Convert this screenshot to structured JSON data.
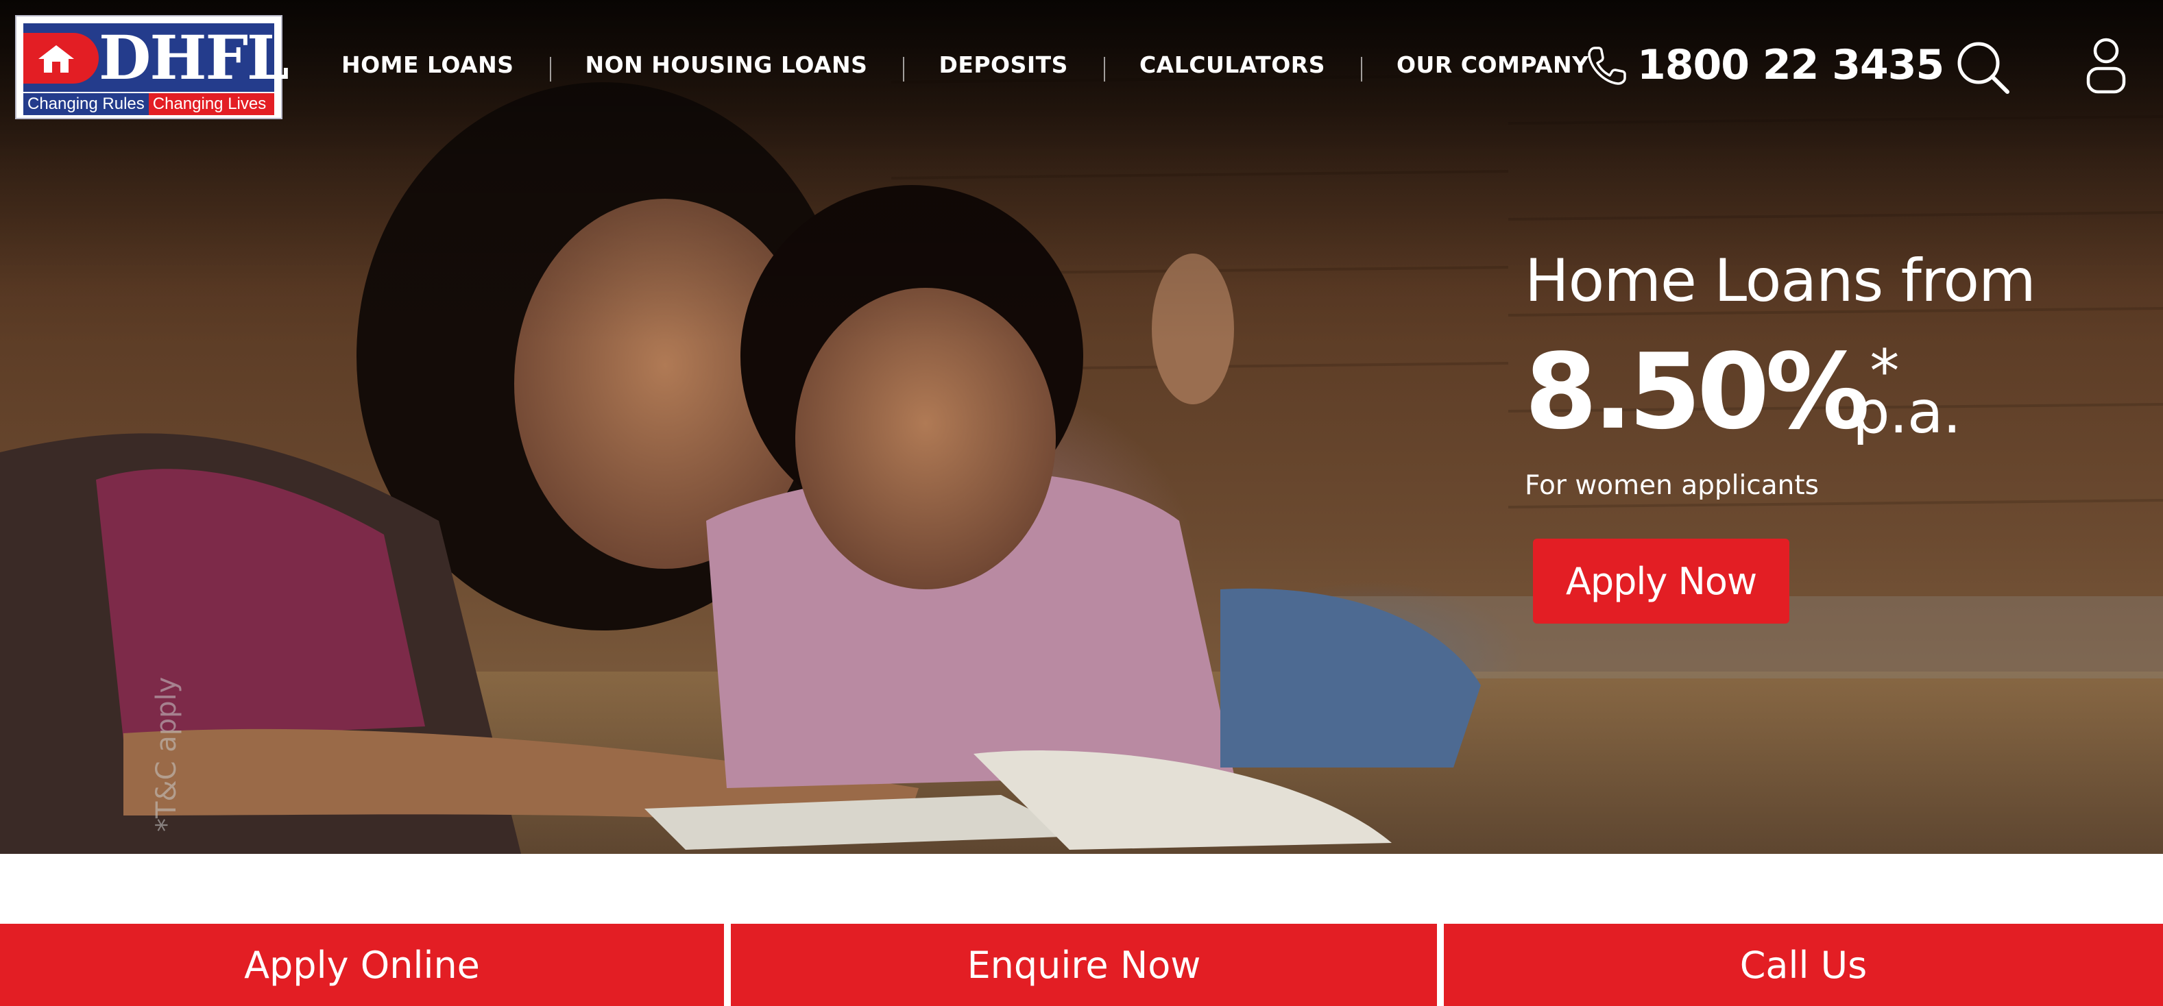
{
  "brand": {
    "logo_text": "DHFL",
    "tagline_part1": "Changing Rules",
    "tagline_part2": "Changing Lives",
    "colors": {
      "red": "#e31e24",
      "blue": "#243c8c"
    }
  },
  "nav": {
    "items": [
      {
        "label": "HOME LOANS"
      },
      {
        "label": "NON HOUSING LOANS"
      },
      {
        "label": "DEPOSITS"
      },
      {
        "label": "CALCULATORS"
      },
      {
        "label": "OUR COMPANY"
      }
    ]
  },
  "header": {
    "phone_number": "1800 22 3435",
    "icons": [
      "phone-icon",
      "search-icon",
      "user-icon"
    ]
  },
  "hero": {
    "headline": "Home Loans from",
    "rate": "8.50%",
    "rate_marker": "*",
    "rate_suffix": "p.a.",
    "subtext": "For women applicants",
    "cta_label": "Apply Now",
    "disclaimer": "*T&C apply"
  },
  "cta_bar": {
    "items": [
      {
        "label": "Apply Online"
      },
      {
        "label": "Enquire Now"
      },
      {
        "label": "Call Us"
      }
    ]
  }
}
